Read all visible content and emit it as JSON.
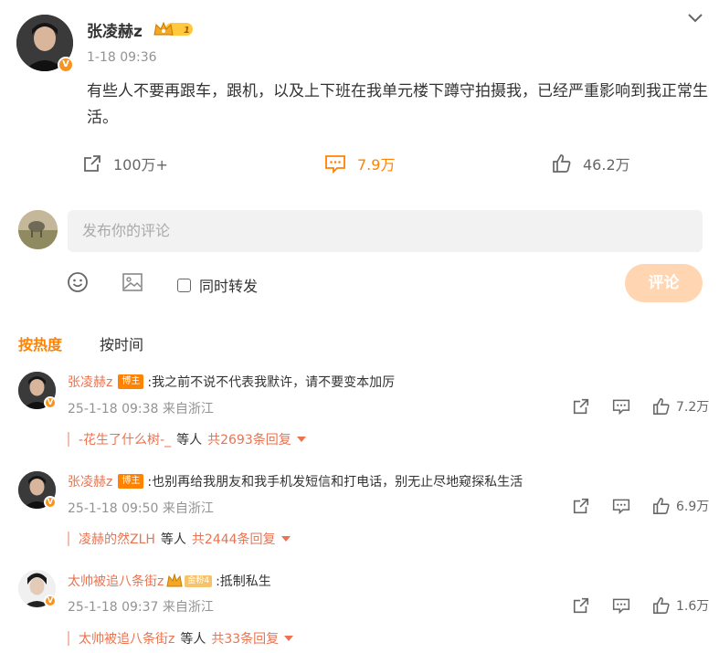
{
  "post": {
    "author": "张凌赫z",
    "crown_level": "1",
    "time": "1-18 09:36",
    "text": "有些人不要再跟车，跟机，以及上下班在我单元楼下蹲守拍摄我，已经严重影响到我正常生活。",
    "reposts": "100万+",
    "comments": "7.9万",
    "likes": "46.2万"
  },
  "composer": {
    "placeholder": "发布你的评论",
    "repost_label": "同时转发",
    "submit_label": "评论"
  },
  "sort_tabs": {
    "hot": "按热度",
    "time": "按时间"
  },
  "comments": [
    {
      "name": "张凌赫z",
      "badge": "博主",
      "text": ":我之前不说不代表我默许，请不要变本加厉",
      "meta": "25-1-18 09:38 来自浙江",
      "likes": "7.2万",
      "reply_who": "-花生了什么树-_",
      "reply_mid": "等人",
      "reply_count": "共2693条回复"
    },
    {
      "name": "张凌赫z",
      "badge": "博主",
      "text": ":也别再给我朋友和我手机发短信和打电话，别无止尽地窥探私生活",
      "meta": "25-1-18 09:50 来自浙江",
      "likes": "6.9万",
      "reply_who": "凌赫的然ZLH",
      "reply_mid": "等人",
      "reply_count": "共2444条回复"
    },
    {
      "name": "太帅被追八条街z",
      "badge": "金粉4",
      "text": ":抵制私生",
      "meta": "25-1-18 09:37 来自浙江",
      "likes": "1.6万",
      "reply_who": "太帅被追八条街z",
      "reply_mid": "等人",
      "reply_count": "共33条回复"
    }
  ],
  "colors": {
    "accent": "#ff8200",
    "name": "#eb7350",
    "submit_disabled": "#ffd5b2",
    "comment_box": "#f2f2f2"
  }
}
